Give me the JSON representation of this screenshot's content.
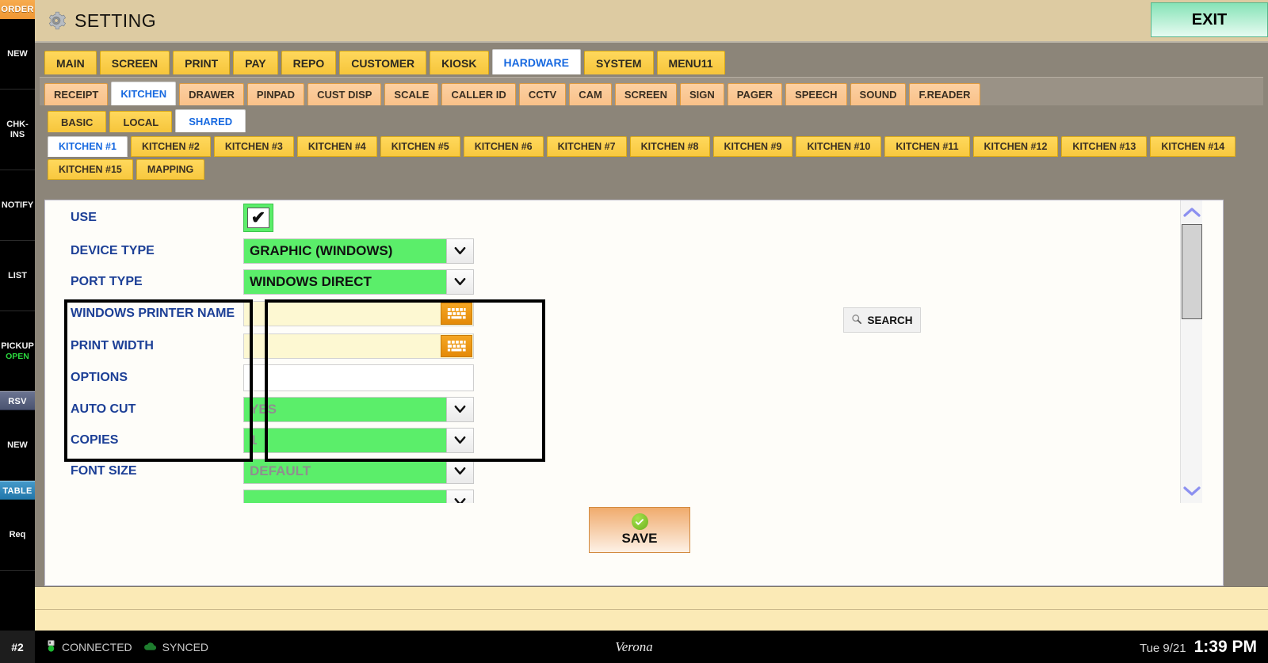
{
  "sidebar": {
    "header_order": "ORDER",
    "items": [
      {
        "label": "NEW",
        "sub": ""
      },
      {
        "label": "CHK-INS",
        "sub": ""
      },
      {
        "label": "NOTIFY",
        "sub": ""
      },
      {
        "label": "LIST",
        "sub": ""
      },
      {
        "label": "PICKUP",
        "sub": "OPEN"
      }
    ],
    "header_rsv": "RSV",
    "items2": [
      {
        "label": "NEW",
        "sub": ""
      }
    ],
    "header_table": "TABLE",
    "items3": [
      {
        "label": "Req",
        "sub": ""
      }
    ]
  },
  "header": {
    "title": "SETTING",
    "gear_icon": "gear-icon",
    "exit_label": "EXIT"
  },
  "tabs_level1": [
    {
      "label": "MAIN",
      "active": false
    },
    {
      "label": "SCREEN",
      "active": false
    },
    {
      "label": "PRINT",
      "active": false
    },
    {
      "label": "PAY",
      "active": false
    },
    {
      "label": "REPO",
      "active": false
    },
    {
      "label": "CUSTOMER",
      "active": false
    },
    {
      "label": "KIOSK",
      "active": false
    },
    {
      "label": "HARDWARE",
      "active": true
    },
    {
      "label": "SYSTEM",
      "active": false
    },
    {
      "label": "MENU11",
      "active": false
    }
  ],
  "tabs_level2": [
    {
      "label": "RECEIPT",
      "active": false
    },
    {
      "label": "KITCHEN",
      "active": true
    },
    {
      "label": "DRAWER",
      "active": false
    },
    {
      "label": "PINPAD",
      "active": false
    },
    {
      "label": "CUST DISP",
      "active": false
    },
    {
      "label": "SCALE",
      "active": false
    },
    {
      "label": "CALLER ID",
      "active": false
    },
    {
      "label": "CCTV",
      "active": false
    },
    {
      "label": "CAM",
      "active": false
    },
    {
      "label": "SCREEN",
      "active": false
    },
    {
      "label": "SIGN",
      "active": false
    },
    {
      "label": "PAGER",
      "active": false
    },
    {
      "label": "SPEECH",
      "active": false
    },
    {
      "label": "SOUND",
      "active": false
    },
    {
      "label": "F.READER",
      "active": false
    }
  ],
  "tabs_level3": [
    {
      "label": "BASIC",
      "active": false
    },
    {
      "label": "LOCAL",
      "active": false
    },
    {
      "label": "SHARED",
      "active": true
    }
  ],
  "tabs_level4": [
    {
      "label": "KITCHEN #1",
      "active": true
    },
    {
      "label": "KITCHEN #2",
      "active": false
    },
    {
      "label": "KITCHEN #3",
      "active": false
    },
    {
      "label": "KITCHEN #4",
      "active": false
    },
    {
      "label": "KITCHEN #5",
      "active": false
    },
    {
      "label": "KITCHEN #6",
      "active": false
    },
    {
      "label": "KITCHEN #7",
      "active": false
    },
    {
      "label": "KITCHEN #8",
      "active": false
    },
    {
      "label": "KITCHEN #9",
      "active": false
    },
    {
      "label": "KITCHEN #10",
      "active": false
    },
    {
      "label": "KITCHEN #11",
      "active": false
    },
    {
      "label": "KITCHEN #12",
      "active": false
    },
    {
      "label": "KITCHEN #13",
      "active": false
    },
    {
      "label": "KITCHEN #14",
      "active": false
    },
    {
      "label": "KITCHEN #15",
      "active": false
    },
    {
      "label": "MAPPING",
      "active": false
    }
  ],
  "form": {
    "use": {
      "label": "USE",
      "checked": true,
      "check_glyph": "✔"
    },
    "device_type": {
      "label": "DEVICE TYPE",
      "value": "GRAPHIC (WINDOWS)",
      "muted": false
    },
    "port_type": {
      "label": "PORT TYPE",
      "value": "WINDOWS DIRECT",
      "muted": false
    },
    "printer_name": {
      "label": "WINDOWS PRINTER NAME",
      "value": "",
      "placeholder": ""
    },
    "print_width": {
      "label": "PRINT WIDTH",
      "value": "",
      "placeholder": ""
    },
    "options": {
      "label": "OPTIONS",
      "value": ""
    },
    "auto_cut": {
      "label": "AUTO CUT",
      "value": "YES",
      "muted": true
    },
    "copies": {
      "label": "COPIES",
      "value": "1",
      "muted": true
    },
    "font_size": {
      "label": "FONT SIZE",
      "value": "DEFAULT",
      "muted": true
    },
    "next_partial": {
      "label": "",
      "value": "",
      "muted": true
    }
  },
  "actions": {
    "search_label": "SEARCH",
    "search_icon": "search-icon",
    "save_label": "SAVE",
    "save_icon": "check-circle-icon"
  },
  "scrollbar": {
    "up_glyph": "⌃",
    "down_glyph": "⌄"
  },
  "statusbar": {
    "station": "#2",
    "connection": "CONNECTED",
    "sync": "SYNCED",
    "brand": "Verona",
    "date": "Tue 9/21",
    "time": "1:39 PM"
  },
  "colors": {
    "tab_yellow": "#f6c53b",
    "tab_peach": "#f9c189",
    "active_tab_text": "#1769e0",
    "label_blue": "#1c3f96",
    "dropdown_green": "#5bee6a",
    "field_cream": "#fdf8d2",
    "keyboard_orange": "#e48a09",
    "exit_green": "#86e3b7",
    "save_orange": "#f0ab6d",
    "sidebar_order": "#ef9733",
    "sidebar_rsv": "#4b5471",
    "sidebar_table": "#2277ab",
    "band_cream": "#fbeab6",
    "window_gray": "#8c8579"
  }
}
